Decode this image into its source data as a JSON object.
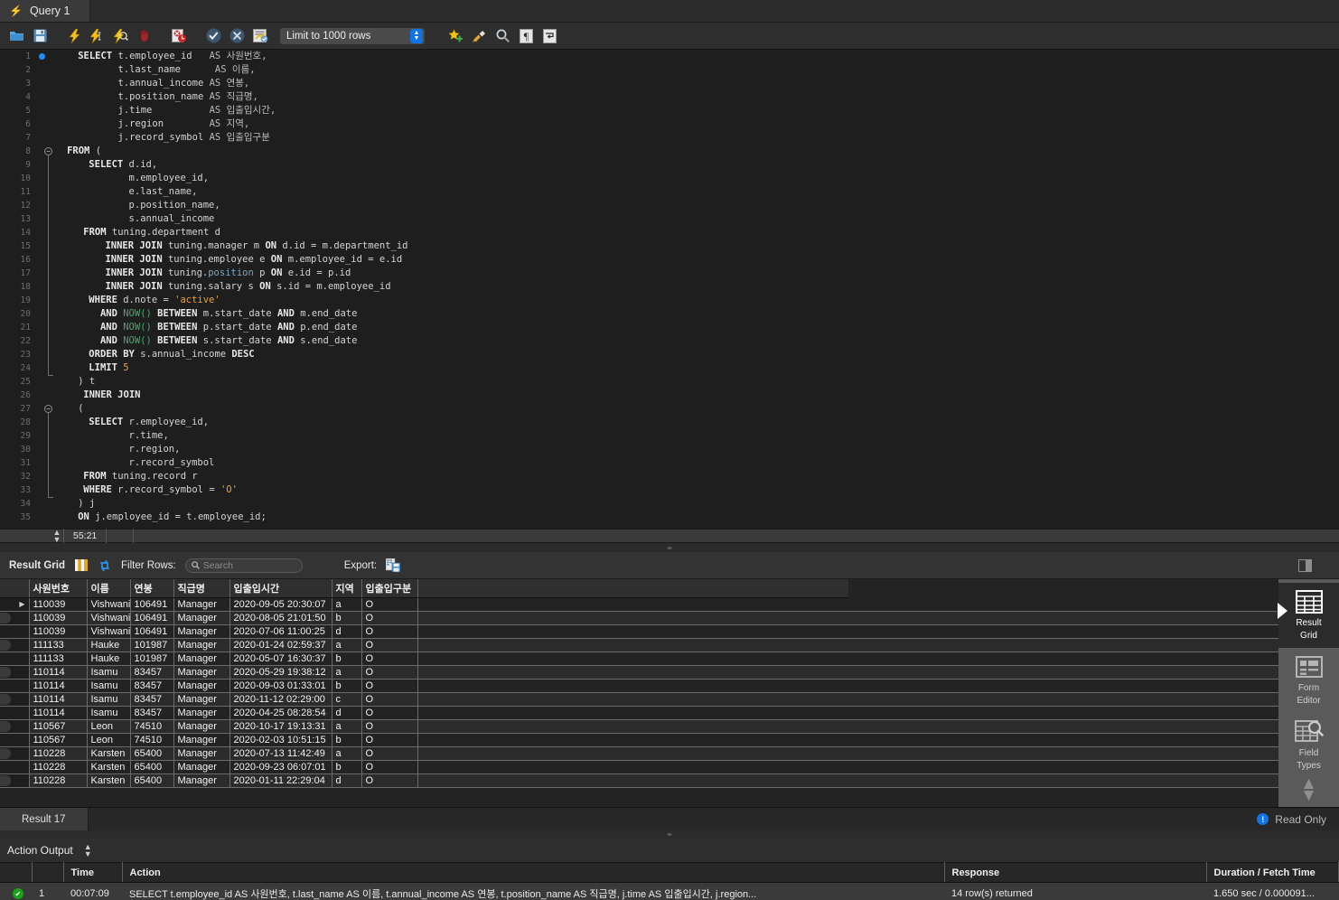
{
  "window": {
    "tab_label": "Query 1",
    "tab_icon": "lightning-bolt-icon"
  },
  "toolbar": {
    "buttons": [
      {
        "name": "open-sql-file-button",
        "glyph": "📁",
        "title": "Open SQL Script"
      },
      {
        "name": "save-sql-file-button",
        "glyph": "💾",
        "title": "Save SQL Script"
      },
      {
        "name": "execute-statement-button",
        "glyph": "⚡",
        "title": "Execute"
      },
      {
        "name": "execute-current-statement-button",
        "glyph": "⚡",
        "title": "Execute Current Statement"
      },
      {
        "name": "explain-statement-button",
        "glyph": "⚡",
        "title": "Explain"
      },
      {
        "name": "stop-query-button",
        "glyph": "✋",
        "title": "Stop"
      },
      {
        "name": "toggle-stop-on-error-button",
        "glyph": "⛔",
        "title": "Toggle Stop On Error"
      },
      {
        "name": "commit-button",
        "glyph": "✔",
        "title": "Commit"
      },
      {
        "name": "rollback-button",
        "glyph": "✖",
        "title": "Rollback"
      },
      {
        "name": "autocommit-button",
        "glyph": "🗐",
        "title": "Toggle Auto-Commit"
      }
    ],
    "limit_select": {
      "name": "row-limit-select",
      "value": "Limit to 1000 rows"
    },
    "right_buttons": [
      {
        "name": "save-snippet-button",
        "glyph": "⭐",
        "title": "Save snippet"
      },
      {
        "name": "beautify-query-button",
        "glyph": "🧹",
        "title": "Beautify Query"
      },
      {
        "name": "find-button",
        "glyph": "🔍",
        "title": "Find"
      },
      {
        "name": "toggle-invisible-chars-button",
        "glyph": "¶",
        "title": "Toggle Invisible Characters"
      },
      {
        "name": "toggle-wrapping-button",
        "glyph": "↵",
        "title": "Toggle Word Wrapping"
      }
    ]
  },
  "editor": {
    "status": {
      "cursor_position": "55:21"
    },
    "lines": [
      {
        "n": 1,
        "indent": 4,
        "tokens": [
          {
            "t": "SELECT",
            "c": "kw"
          },
          {
            "t": " t.employee_id   ",
            "c": "txt"
          },
          {
            "t": "AS",
            "c": "kw2"
          },
          {
            "t": " ",
            "c": "txt"
          },
          {
            "t": "사원번호,",
            "c": "kor"
          }
        ]
      },
      {
        "n": 2,
        "indent": 4,
        "tokens": [
          {
            "t": "       t.last_name      ",
            "c": "txt"
          },
          {
            "t": "AS",
            "c": "kw2"
          },
          {
            "t": " ",
            "c": "txt"
          },
          {
            "t": "이름,",
            "c": "kor"
          }
        ]
      },
      {
        "n": 3,
        "indent": 4,
        "tokens": [
          {
            "t": "       t.annual_income ",
            "c": "txt"
          },
          {
            "t": "AS",
            "c": "kw2"
          },
          {
            "t": " ",
            "c": "txt"
          },
          {
            "t": "연봉,",
            "c": "kor"
          }
        ]
      },
      {
        "n": 4,
        "indent": 4,
        "tokens": [
          {
            "t": "       t.position_name ",
            "c": "txt"
          },
          {
            "t": "AS",
            "c": "kw2"
          },
          {
            "t": " ",
            "c": "txt"
          },
          {
            "t": "직급명,",
            "c": "kor"
          }
        ]
      },
      {
        "n": 5,
        "indent": 4,
        "tokens": [
          {
            "t": "       j.time          ",
            "c": "txt"
          },
          {
            "t": "AS",
            "c": "kw2"
          },
          {
            "t": " ",
            "c": "txt"
          },
          {
            "t": "입출입시간,",
            "c": "kor"
          }
        ]
      },
      {
        "n": 6,
        "indent": 4,
        "tokens": [
          {
            "t": "       j.region        ",
            "c": "txt"
          },
          {
            "t": "AS",
            "c": "kw2"
          },
          {
            "t": " ",
            "c": "txt"
          },
          {
            "t": "지역,",
            "c": "kor"
          }
        ]
      },
      {
        "n": 7,
        "indent": 4,
        "tokens": [
          {
            "t": "       j.record_symbol ",
            "c": "txt"
          },
          {
            "t": "AS",
            "c": "kw2"
          },
          {
            "t": " ",
            "c": "txt"
          },
          {
            "t": "입출입구분",
            "c": "kor"
          }
        ]
      },
      {
        "n": 8,
        "indent": 2,
        "fold": "start",
        "tokens": [
          {
            "t": "FROM",
            "c": "kw"
          },
          {
            "t": " (",
            "c": "txt"
          }
        ]
      },
      {
        "n": 9,
        "indent": 6,
        "tokens": [
          {
            "t": "SELECT",
            "c": "kw"
          },
          {
            "t": " d.id,",
            "c": "txt"
          }
        ]
      },
      {
        "n": 10,
        "indent": 6,
        "tokens": [
          {
            "t": "       m.employee_id,",
            "c": "txt"
          }
        ]
      },
      {
        "n": 11,
        "indent": 6,
        "tokens": [
          {
            "t": "       e.last_name,",
            "c": "txt"
          }
        ]
      },
      {
        "n": 12,
        "indent": 6,
        "tokens": [
          {
            "t": "       p.position_name,",
            "c": "txt"
          }
        ]
      },
      {
        "n": 13,
        "indent": 6,
        "tokens": [
          {
            "t": "       s.annual_income",
            "c": "txt"
          }
        ]
      },
      {
        "n": 14,
        "indent": 5,
        "tokens": [
          {
            "t": "FROM",
            "c": "kw"
          },
          {
            "t": " tuning.department d",
            "c": "txt"
          }
        ]
      },
      {
        "n": 15,
        "indent": 9,
        "tokens": [
          {
            "t": "INNER JOIN",
            "c": "kw"
          },
          {
            "t": " tuning.manager m ",
            "c": "txt"
          },
          {
            "t": "ON",
            "c": "kw"
          },
          {
            "t": " d.id = m.department_id",
            "c": "txt"
          }
        ]
      },
      {
        "n": 16,
        "indent": 9,
        "tokens": [
          {
            "t": "INNER JOIN",
            "c": "kw"
          },
          {
            "t": " tuning.employee e ",
            "c": "txt"
          },
          {
            "t": "ON",
            "c": "kw"
          },
          {
            "t": " m.employee_id = e.id",
            "c": "txt"
          }
        ]
      },
      {
        "n": 17,
        "indent": 9,
        "tokens": [
          {
            "t": "INNER JOIN",
            "c": "kw"
          },
          {
            "t": " tuning.",
            "c": "txt"
          },
          {
            "t": "position",
            "c": "tbl"
          },
          {
            "t": " p ",
            "c": "txt"
          },
          {
            "t": "ON",
            "c": "kw"
          },
          {
            "t": " e.id = p.id",
            "c": "txt"
          }
        ]
      },
      {
        "n": 18,
        "indent": 9,
        "tokens": [
          {
            "t": "INNER JOIN",
            "c": "kw"
          },
          {
            "t": " tuning.salary s ",
            "c": "txt"
          },
          {
            "t": "ON",
            "c": "kw"
          },
          {
            "t": " s.id = m.employee_id",
            "c": "txt"
          }
        ]
      },
      {
        "n": 19,
        "indent": 6,
        "tokens": [
          {
            "t": "WHERE",
            "c": "kw"
          },
          {
            "t": " d.note = ",
            "c": "txt"
          },
          {
            "t": "'active'",
            "c": "str"
          }
        ]
      },
      {
        "n": 20,
        "indent": 6,
        "tokens": [
          {
            "t": "  AND ",
            "c": "kw"
          },
          {
            "t": "NOW()",
            "c": "fn"
          },
          {
            "t": " BETWEEN",
            "c": "kw"
          },
          {
            "t": " m.start_date ",
            "c": "txt"
          },
          {
            "t": "AND",
            "c": "kw"
          },
          {
            "t": " m.end_date",
            "c": "txt"
          }
        ]
      },
      {
        "n": 21,
        "indent": 6,
        "tokens": [
          {
            "t": "  AND ",
            "c": "kw"
          },
          {
            "t": "NOW()",
            "c": "fn"
          },
          {
            "t": " BETWEEN",
            "c": "kw"
          },
          {
            "t": " p.start_date ",
            "c": "txt"
          },
          {
            "t": "AND",
            "c": "kw"
          },
          {
            "t": " p.end_date",
            "c": "txt"
          }
        ]
      },
      {
        "n": 22,
        "indent": 6,
        "tokens": [
          {
            "t": "  AND ",
            "c": "kw"
          },
          {
            "t": "NOW()",
            "c": "fn"
          },
          {
            "t": " BETWEEN",
            "c": "kw"
          },
          {
            "t": " s.start_date ",
            "c": "txt"
          },
          {
            "t": "AND",
            "c": "kw"
          },
          {
            "t": " s.end_date",
            "c": "txt"
          }
        ]
      },
      {
        "n": 23,
        "indent": 6,
        "tokens": [
          {
            "t": "ORDER BY",
            "c": "kw"
          },
          {
            "t": " s.annual_income ",
            "c": "txt"
          },
          {
            "t": "DESC",
            "c": "kw"
          }
        ]
      },
      {
        "n": 24,
        "indent": 6,
        "tokens": [
          {
            "t": "LIMIT ",
            "c": "kw"
          },
          {
            "t": "5",
            "c": "num"
          }
        ]
      },
      {
        "n": 25,
        "indent": 4,
        "fold": "end",
        "tokens": [
          {
            "t": ") t",
            "c": "txt"
          }
        ]
      },
      {
        "n": 26,
        "indent": 5,
        "tokens": [
          {
            "t": "INNER JOIN",
            "c": "kw"
          }
        ]
      },
      {
        "n": 27,
        "indent": 4,
        "fold": "start",
        "tokens": [
          {
            "t": "(",
            "c": "txt"
          }
        ]
      },
      {
        "n": 28,
        "indent": 6,
        "tokens": [
          {
            "t": "SELECT",
            "c": "kw"
          },
          {
            "t": " r.employee_id,",
            "c": "txt"
          }
        ]
      },
      {
        "n": 29,
        "indent": 6,
        "tokens": [
          {
            "t": "       r.time,",
            "c": "txt"
          }
        ]
      },
      {
        "n": 30,
        "indent": 6,
        "tokens": [
          {
            "t": "       r.region,",
            "c": "txt"
          }
        ]
      },
      {
        "n": 31,
        "indent": 6,
        "tokens": [
          {
            "t": "       r.record_symbol",
            "c": "txt"
          }
        ]
      },
      {
        "n": 32,
        "indent": 5,
        "tokens": [
          {
            "t": "FROM",
            "c": "kw"
          },
          {
            "t": " tuning.record r",
            "c": "txt"
          }
        ]
      },
      {
        "n": 33,
        "indent": 5,
        "tokens": [
          {
            "t": "WHERE",
            "c": "kw"
          },
          {
            "t": " r.record_symbol = ",
            "c": "txt"
          },
          {
            "t": "'O'",
            "c": "str"
          }
        ]
      },
      {
        "n": 34,
        "indent": 4,
        "fold": "end",
        "tokens": [
          {
            "t": ") j",
            "c": "txt"
          }
        ]
      },
      {
        "n": 35,
        "indent": 4,
        "tokens": [
          {
            "t": "ON",
            "c": "kw"
          },
          {
            "t": " j.employee_id = t.employee_id;",
            "c": "txt"
          }
        ]
      }
    ]
  },
  "result_toolbar": {
    "title": "Result Grid",
    "filter_label": "Filter Rows:",
    "search_placeholder": "Search",
    "search_value": "",
    "export_label": "Export:",
    "icons": {
      "grid_view": "grid-columns-icon",
      "refresh": "refresh-icon",
      "search": "search-icon",
      "export": "export-icon",
      "panel_toggle": "panel-toggle-icon"
    }
  },
  "grid": {
    "columns": [
      "사원번호",
      "이름",
      "연봉",
      "직급명",
      "입출입시간",
      "지역",
      "입출입구분",
      ""
    ],
    "rows": [
      [
        "110039",
        "Vishwani",
        "106491",
        "Manager",
        "2020-09-05 20:30:07",
        "a",
        "O",
        ""
      ],
      [
        "110039",
        "Vishwani",
        "106491",
        "Manager",
        "2020-08-05 21:01:50",
        "b",
        "O",
        ""
      ],
      [
        "110039",
        "Vishwani",
        "106491",
        "Manager",
        "2020-07-06 11:00:25",
        "d",
        "O",
        ""
      ],
      [
        "111133",
        "Hauke",
        "101987",
        "Manager",
        "2020-01-24 02:59:37",
        "a",
        "O",
        ""
      ],
      [
        "111133",
        "Hauke",
        "101987",
        "Manager",
        "2020-05-07 16:30:37",
        "b",
        "O",
        ""
      ],
      [
        "110114",
        "Isamu",
        "83457",
        "Manager",
        "2020-05-29 19:38:12",
        "a",
        "O",
        ""
      ],
      [
        "110114",
        "Isamu",
        "83457",
        "Manager",
        "2020-09-03 01:33:01",
        "b",
        "O",
        ""
      ],
      [
        "110114",
        "Isamu",
        "83457",
        "Manager",
        "2020-11-12 02:29:00",
        "c",
        "O",
        ""
      ],
      [
        "110114",
        "Isamu",
        "83457",
        "Manager",
        "2020-04-25 08:28:54",
        "d",
        "O",
        ""
      ],
      [
        "110567",
        "Leon",
        "74510",
        "Manager",
        "2020-10-17 19:13:31",
        "a",
        "O",
        ""
      ],
      [
        "110567",
        "Leon",
        "74510",
        "Manager",
        "2020-02-03 10:51:15",
        "b",
        "O",
        ""
      ],
      [
        "110228",
        "Karsten",
        "65400",
        "Manager",
        "2020-07-13 11:42:49",
        "a",
        "O",
        ""
      ],
      [
        "110228",
        "Karsten",
        "65400",
        "Manager",
        "2020-09-23 06:07:01",
        "b",
        "O",
        ""
      ],
      [
        "110228",
        "Karsten",
        "65400",
        "Manager",
        "2020-01-11 22:29:04",
        "d",
        "O",
        ""
      ]
    ]
  },
  "sidebar": {
    "items": [
      {
        "label_line1": "Result",
        "label_line2": "Grid",
        "icon": "result-grid-icon",
        "active": true
      },
      {
        "label_line1": "Form",
        "label_line2": "Editor",
        "icon": "form-editor-icon",
        "active": false
      },
      {
        "label_line1": "Field",
        "label_line2": "Types",
        "icon": "field-types-icon",
        "active": false
      }
    ],
    "scroll_glyph": "↕"
  },
  "result_tabs": {
    "tabs": [
      {
        "label": "Result 17",
        "active": true
      }
    ],
    "read_only_label": "Read Only",
    "read_only_icon": "info-icon"
  },
  "action_output": {
    "title": "Action Output",
    "selector_glyph": "↕",
    "columns": [
      "",
      "",
      "Time",
      "Action",
      "Response",
      "Duration / Fetch Time"
    ],
    "rows": [
      {
        "status": "success",
        "index": "1",
        "time": "00:07:09",
        "action": "SELECT t.employee_id   AS 사원번호,      t.last_name    AS 이름,      t.annual_income AS 연봉,      t.position_name AS 직급명,     j.time      AS 입출입시간,     j.region...",
        "response": "14 row(s) returned",
        "duration": "1.650 sec / 0.000091..."
      }
    ]
  },
  "colors": {
    "accent_blue": "#1273e6",
    "success_green": "#19a319",
    "string_orange": "#e8a33d",
    "function_green": "#4ea36b"
  }
}
